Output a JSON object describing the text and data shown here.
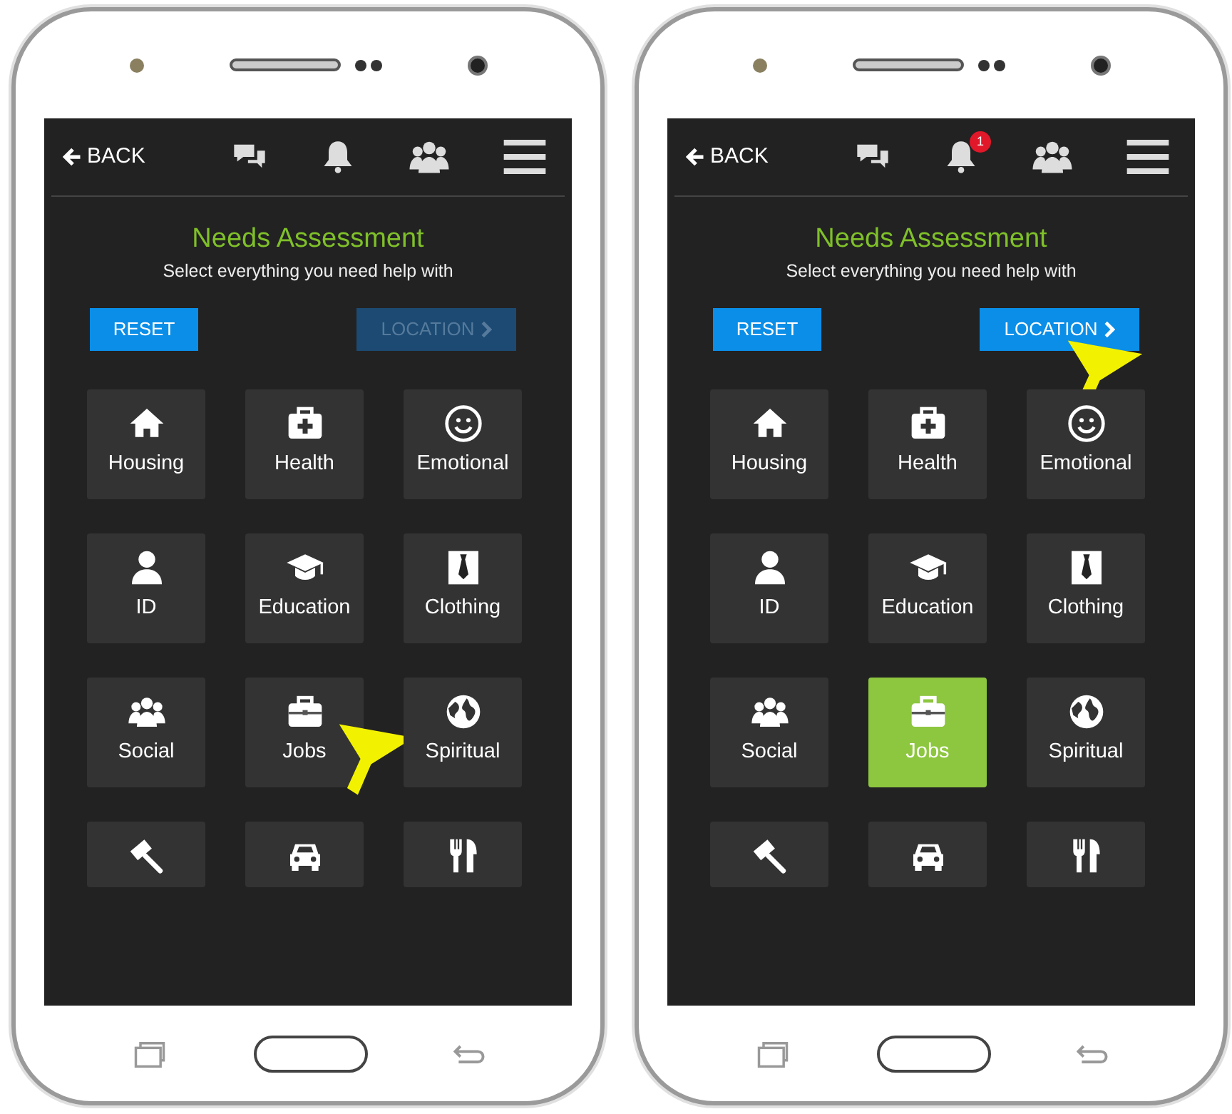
{
  "phones": [
    {
      "header": {
        "back": "BACK"
      },
      "title": "Needs Assessment",
      "subtitle": "Select everything you need help with",
      "reset": "RESET",
      "location": {
        "label": "LOCATION",
        "disabled": true,
        "pointer": false
      },
      "tiles": [
        {
          "kind": "housing",
          "label": "Housing",
          "selected": false,
          "pointer": false
        },
        {
          "kind": "health",
          "label": "Health",
          "selected": false,
          "pointer": false
        },
        {
          "kind": "emotional",
          "label": "Emotional",
          "selected": false,
          "pointer": false
        },
        {
          "kind": "id",
          "label": "ID",
          "selected": false,
          "pointer": false
        },
        {
          "kind": "education",
          "label": "Education",
          "selected": false,
          "pointer": false
        },
        {
          "kind": "clothing",
          "label": "Clothing",
          "selected": false,
          "pointer": false
        },
        {
          "kind": "social",
          "label": "Social",
          "selected": false,
          "pointer": false
        },
        {
          "kind": "jobs",
          "label": "Jobs",
          "selected": false,
          "pointer": true
        },
        {
          "kind": "spiritual",
          "label": "Spiritual",
          "selected": false,
          "pointer": false
        },
        {
          "kind": "legal",
          "selected": false,
          "pointer": false
        },
        {
          "kind": "car",
          "selected": false,
          "pointer": false
        },
        {
          "kind": "food",
          "selected": false,
          "pointer": false
        }
      ]
    },
    {
      "header": {
        "back": "BACK",
        "bell_badge": "1"
      },
      "title": "Needs Assessment",
      "subtitle": "Select everything you need help with",
      "reset": "RESET",
      "location": {
        "label": "LOCATION",
        "disabled": false,
        "pointer": true
      },
      "tiles": [
        {
          "kind": "housing",
          "label": "Housing",
          "selected": false,
          "pointer": false
        },
        {
          "kind": "health",
          "label": "Health",
          "selected": false,
          "pointer": false
        },
        {
          "kind": "emotional",
          "label": "Emotional",
          "selected": false,
          "pointer": false
        },
        {
          "kind": "id",
          "label": "ID",
          "selected": false,
          "pointer": false
        },
        {
          "kind": "education",
          "label": "Education",
          "selected": false,
          "pointer": false
        },
        {
          "kind": "clothing",
          "label": "Clothing",
          "selected": false,
          "pointer": false
        },
        {
          "kind": "social",
          "label": "Social",
          "selected": false,
          "pointer": false
        },
        {
          "kind": "jobs",
          "label": "Jobs",
          "selected": true,
          "pointer": false
        },
        {
          "kind": "spiritual",
          "label": "Spiritual",
          "selected": false,
          "pointer": false
        },
        {
          "kind": "legal",
          "selected": false,
          "pointer": false
        },
        {
          "kind": "car",
          "selected": false,
          "pointer": false
        },
        {
          "kind": "food",
          "selected": false,
          "pointer": false
        }
      ]
    }
  ]
}
